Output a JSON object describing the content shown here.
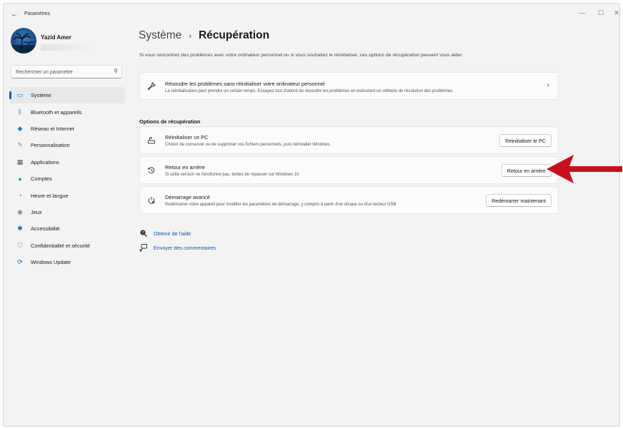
{
  "titlebar": {
    "app_title": "Paramètres",
    "back_glyph": "←",
    "minimize_glyph": "—",
    "maximize_glyph": "☐",
    "close_glyph": "✕"
  },
  "profile": {
    "name": "Yazid Amer"
  },
  "search": {
    "placeholder": "Rechercher un paramètre",
    "icon": "search-icon"
  },
  "sidebar": {
    "items": [
      {
        "label": "Système",
        "icon": "system-icon",
        "glyph": "▭",
        "color": "#0078d4",
        "active": true
      },
      {
        "label": "Bluetooth et appareils",
        "icon": "bluetooth-icon",
        "glyph": "ᛒ",
        "color": "#0067c0",
        "active": false
      },
      {
        "label": "Réseau et Internet",
        "icon": "wifi-icon",
        "glyph": "◆",
        "color": "#1b7fd1",
        "active": false
      },
      {
        "label": "Personnalisation",
        "icon": "brush-icon",
        "glyph": "✎",
        "color": "#d4702c",
        "active": false
      },
      {
        "label": "Applications",
        "icon": "apps-icon",
        "glyph": "▦",
        "color": "#4c5966",
        "active": false
      },
      {
        "label": "Comptes",
        "icon": "account-icon",
        "glyph": "●",
        "color": "#1aa36b",
        "active": false
      },
      {
        "label": "Heure et langue",
        "icon": "globe-clock-icon",
        "glyph": "◔",
        "color": "#2d7ccb",
        "active": false
      },
      {
        "label": "Jeux",
        "icon": "gamepad-icon",
        "glyph": "◉",
        "color": "#7a8794",
        "active": false
      },
      {
        "label": "Accessibilité",
        "icon": "accessibility-icon",
        "glyph": "✱",
        "color": "#1e5fa8",
        "active": false
      },
      {
        "label": "Confidentialité et sécurité",
        "icon": "shield-icon",
        "glyph": "⛉",
        "color": "#7b8590",
        "active": false
      },
      {
        "label": "Windows Update",
        "icon": "update-icon",
        "glyph": "⟳",
        "color": "#0f6cbd",
        "active": false
      }
    ]
  },
  "main": {
    "breadcrumb_parent": "Système",
    "breadcrumb_sep": "›",
    "breadcrumb_current": "Récupération",
    "intro": "Si vous rencontrez des problèmes avec votre ordinateur personnel ou si vous souhaitez le réinitialiser, ces options de récupération peuvent vous aider.",
    "troubleshoot": {
      "title": "Résoudre les problèmes sans réinitialiser votre ordinateur personnel",
      "desc": "La réinitialisation peut prendre un certain temps. Essayez tout d'abord de résoudre les problèmes en exécutant un utilitaire de résolution des problèmes.",
      "icon": "wrench-icon",
      "chevron": "›"
    },
    "section_title": "Options de récupération",
    "options": [
      {
        "title": "Réinitialiser ce PC",
        "desc": "Choisir de conserver ou de supprimer vos fichiers personnels, puis réinstaller Windows",
        "button": "Réinitialiser le PC",
        "icon": "reset-pc-icon"
      },
      {
        "title": "Retour en arrière",
        "desc": "Si cette version ne fonctionne pas, tentez de repasser sur Windows 10",
        "button": "Retour en arrière",
        "icon": "history-icon"
      },
      {
        "title": "Démarrage avancé",
        "desc": "Redémarrer votre appareil pour modifier les paramètres de démarrage, y compris à partir d'un disque ou d'un lecteur USB",
        "button": "Redémarrer maintenant",
        "icon": "advanced-startup-icon"
      }
    ],
    "links": [
      {
        "label": "Obtenir de l'aide",
        "icon": "help-icon"
      },
      {
        "label": "Envoyer des commentaires",
        "icon": "feedback-icon"
      }
    ]
  },
  "annotation": {
    "arrow_color": "#c8101a"
  }
}
